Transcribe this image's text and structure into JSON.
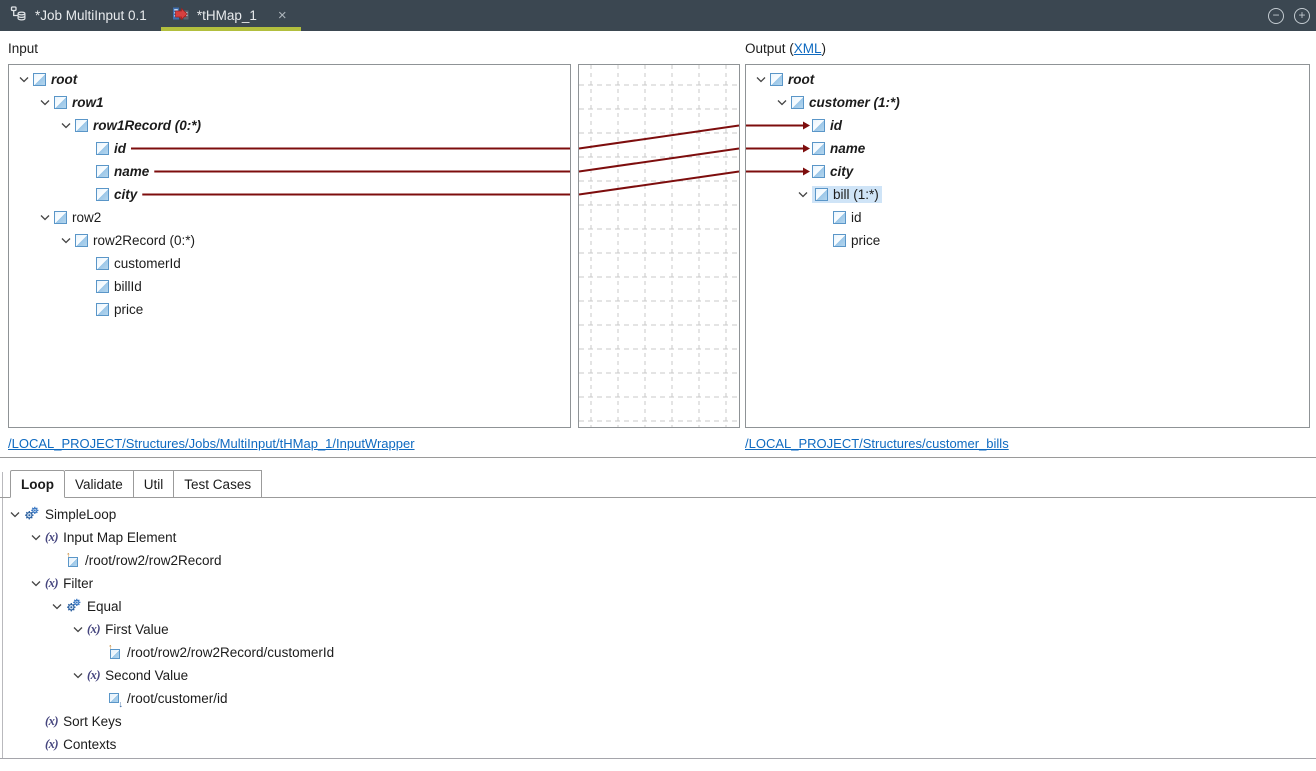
{
  "topbar": {
    "tabs": [
      {
        "label": "*Job MultiInput 0.1",
        "icon": "job-designer-icon",
        "active": false
      },
      {
        "label": "*tHMap_1",
        "icon": "thmap-component-icon",
        "active": true,
        "close_label": "×"
      }
    ],
    "window_buttons": [
      {
        "name": "collapse-circle-icon",
        "glyph": "−"
      },
      {
        "name": "expand-circle-icon",
        "glyph": "+"
      }
    ]
  },
  "input_panel": {
    "title": "Input",
    "link": "/LOCAL_PROJECT/Structures/Jobs/MultiInput/tHMap_1/InputWrapper",
    "tree": [
      {
        "label": "root",
        "depth": 0,
        "expanded": true,
        "mapped": true
      },
      {
        "label": "row1",
        "depth": 1,
        "expanded": true,
        "mapped": true
      },
      {
        "label": "row1Record (0:*)",
        "depth": 2,
        "expanded": true,
        "mapped": true
      },
      {
        "label": "id",
        "depth": 3,
        "mapped": true
      },
      {
        "label": "name",
        "depth": 3,
        "mapped": true
      },
      {
        "label": "city",
        "depth": 3,
        "mapped": true
      },
      {
        "label": "row2",
        "depth": 1,
        "expanded": true
      },
      {
        "label": "row2Record (0:*)",
        "depth": 2,
        "expanded": true
      },
      {
        "label": "customerId",
        "depth": 3
      },
      {
        "label": "billId",
        "depth": 3
      },
      {
        "label": "price",
        "depth": 3
      }
    ]
  },
  "output_panel": {
    "title_prefix": "Output (",
    "title_link": "XML",
    "title_suffix": ")",
    "link": "/LOCAL_PROJECT/Structures/customer_bills",
    "tree": [
      {
        "label": "root",
        "depth": 0,
        "expanded": true,
        "mapped": true
      },
      {
        "label": "customer (1:*)",
        "depth": 1,
        "expanded": true,
        "mapped": true
      },
      {
        "label": "id",
        "depth": 2,
        "mapped": true
      },
      {
        "label": "name",
        "depth": 2,
        "mapped": true
      },
      {
        "label": "city",
        "depth": 2,
        "mapped": true
      },
      {
        "label": "bill (1:*)",
        "depth": 2,
        "expanded": true,
        "selected": true
      },
      {
        "label": "id",
        "depth": 3
      },
      {
        "label": "price",
        "depth": 3
      }
    ]
  },
  "connections": [
    {
      "input_index": 3,
      "output_index": 2
    },
    {
      "input_index": 4,
      "output_index": 3
    },
    {
      "input_index": 5,
      "output_index": 4
    }
  ],
  "bottom_panel": {
    "tabs": [
      {
        "label": "Loop",
        "active": true
      },
      {
        "label": "Validate",
        "active": false
      },
      {
        "label": "Util",
        "active": false
      },
      {
        "label": "Test Cases",
        "active": false
      }
    ],
    "tree": [
      {
        "label": "SimpleLoop",
        "icon": "gears-icon",
        "depth": 0,
        "expanded": true
      },
      {
        "label": "Input Map Element",
        "icon": "fx-icon",
        "depth": 1,
        "expanded": true
      },
      {
        "label": "/root/row2/row2Record",
        "icon": "input-element-icon",
        "depth": 2
      },
      {
        "label": "Filter",
        "icon": "fx-icon",
        "depth": 1,
        "expanded": true
      },
      {
        "label": "Equal",
        "icon": "gears-icon",
        "depth": 2,
        "expanded": true
      },
      {
        "label": "First Value",
        "icon": "fx-icon",
        "depth": 3,
        "expanded": true
      },
      {
        "label": "/root/row2/row2Record/customerId",
        "icon": "input-element-icon",
        "depth": 4
      },
      {
        "label": "Second Value",
        "icon": "fx-icon",
        "depth": 3,
        "expanded": true
      },
      {
        "label": "/root/customer/id",
        "icon": "output-element-icon",
        "depth": 4
      },
      {
        "label": "Sort Keys",
        "icon": "fx-icon",
        "depth": 1
      },
      {
        "label": "Contexts",
        "icon": "fx-icon",
        "depth": 1
      }
    ]
  },
  "colors": {
    "topbar_bg": "#3b4751",
    "active_tab_underline": "#b2bf3e",
    "connection_line": "#7d0d0d",
    "link_blue": "#0f6ac0",
    "selection_highlight": "#cfe4f7",
    "grid_dash": "#c9c9c9",
    "panel_border": "#8f9396"
  }
}
